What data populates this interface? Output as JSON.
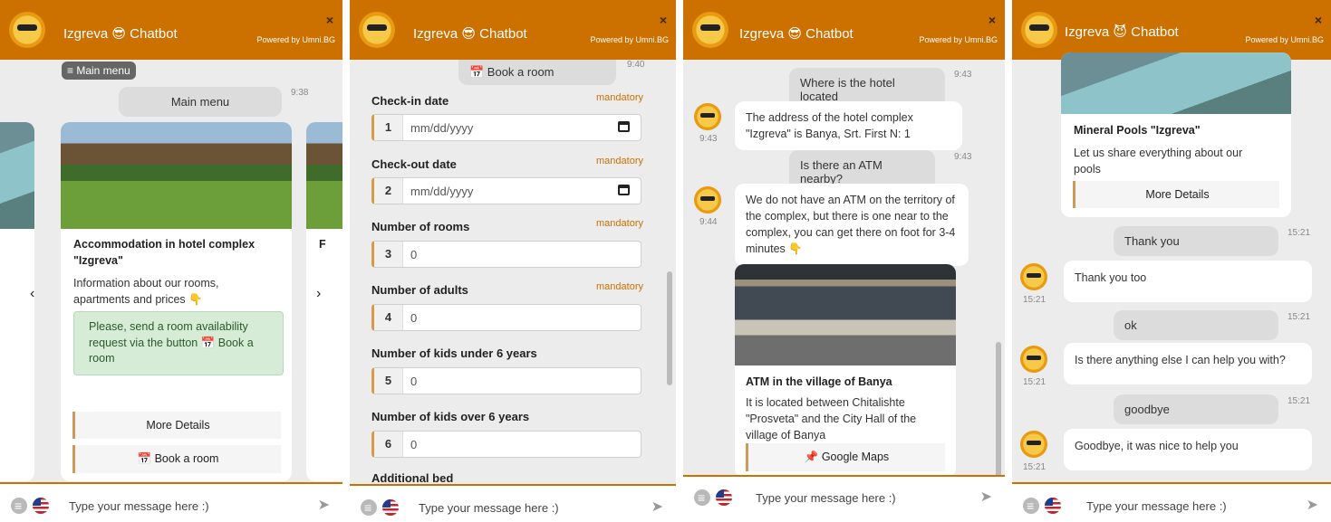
{
  "common": {
    "title": "Izgreva 😎 Chatbot",
    "title_variant": "Izgreva 😈 Chatbot",
    "close_label": "×",
    "powered_by": "Powered by Umni.BG",
    "input_placeholder": "Type your message here :)",
    "send_label": "➤"
  },
  "panel1": {
    "menu_pill": "≡ Main menu",
    "user_msg": "Main menu",
    "user_time": "9:38",
    "card_title": "Accommodation in hotel complex \"Izgreva\"",
    "card_text": "Information about our rooms, apartments and prices 👇",
    "notice": "Please, send a room availability request via the button 📅 Book a room",
    "more_details": "More Details",
    "book_room": "📅 Book a room",
    "prev": "‹",
    "next": "›",
    "side_card_letter": "F"
  },
  "panel2": {
    "header_btn": "📅 Book a room",
    "header_time": "9:40",
    "mandatory": "mandatory",
    "fields": [
      {
        "label": "Check-in date",
        "num": "1",
        "placeholder": "mm/dd/yyyy"
      },
      {
        "label": "Check-out date",
        "num": "2",
        "placeholder": "mm/dd/yyyy"
      },
      {
        "label": "Number of rooms",
        "num": "3",
        "placeholder": "0"
      },
      {
        "label": "Number of adults",
        "num": "4",
        "placeholder": "0"
      },
      {
        "label": "Number of kids under 6 years",
        "num": "5",
        "placeholder": "0"
      },
      {
        "label": "Number of kids over 6 years",
        "num": "6",
        "placeholder": "0"
      },
      {
        "label": "Additional bed"
      }
    ]
  },
  "panel3": {
    "msg1": "Where is the hotel located",
    "time1": "9:43",
    "bot1": "The address of the hotel complex \"Izgreva\" is Banya, Srt. First N: 1",
    "bot1_time": "9:43",
    "msg2": "Is there an ATM nearby?",
    "time2": "9:43",
    "bot2": "We do not have an ATM on the territory of the complex, but there is one near to the complex, you can get there on foot for 3-4 minutes 👇",
    "bot2_time": "9:44",
    "card_title": "ATM in the village of Banya",
    "card_text": "It is located between Chitalishte \"Prosveta\" and the City Hall of the village of Banya",
    "card_btn": "📌 Google Maps"
  },
  "panel4": {
    "card_title": "Mineral Pools \"Izgreva\"",
    "card_text": "Let us share everything about our pools",
    "card_btn": "More Details",
    "msgs": [
      {
        "user": "Thank you",
        "user_time": "15:21",
        "bot": "Thank you too",
        "bot_time": "15:21"
      },
      {
        "user": "ok",
        "user_time": "15:21",
        "bot": "Is there anything else I can help you with?",
        "bot_time": "15:21"
      },
      {
        "user": "goodbye",
        "user_time": "15:21",
        "bot": "Goodbye, it was nice to help you",
        "bot_time": "15:21"
      }
    ]
  }
}
